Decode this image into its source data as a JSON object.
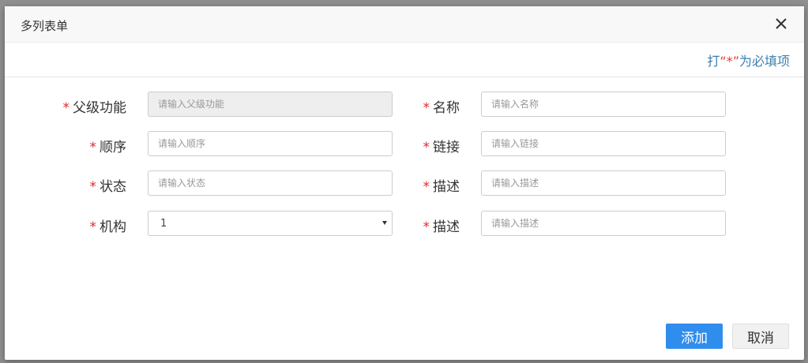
{
  "dialog": {
    "title": "多列表单",
    "close_icon": "close-icon"
  },
  "notice": {
    "prefix": "打",
    "star": "“*”",
    "suffix": "为必填项"
  },
  "required_mark": "*",
  "form": {
    "parent_function": {
      "label": "父级功能",
      "placeholder": "请输入父级功能",
      "disabled": true
    },
    "name": {
      "label": "名称",
      "placeholder": "请输入名称"
    },
    "order": {
      "label": "顺序",
      "placeholder": "请输入顺序"
    },
    "link": {
      "label": "链接",
      "placeholder": "请输入链接"
    },
    "status": {
      "label": "状态",
      "placeholder": "请输入状态"
    },
    "description": {
      "label": "描述",
      "placeholder": "请输入描述"
    },
    "organization": {
      "label": "机构",
      "selected": "1"
    },
    "description_2": {
      "label": "描述",
      "placeholder": "请输入描述"
    }
  },
  "buttons": {
    "add": "添加",
    "cancel": "取消"
  },
  "colors": {
    "accent": "#2f8ded",
    "required": "#e3262b",
    "notice_text": "#3d7fae"
  }
}
